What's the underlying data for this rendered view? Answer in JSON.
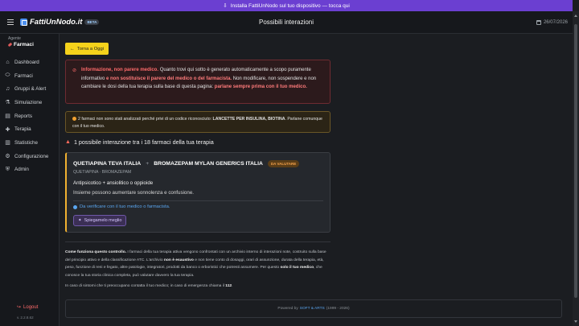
{
  "banner": {
    "icon": "download-icon",
    "text": "Installa FattiUnNodo sul tuo dispositivo — tocca qui"
  },
  "header": {
    "logo_text": "FattiUnNodo.it",
    "logo_badge": "BETA",
    "title": "Possibili interazioni",
    "date": "26/07/2026"
  },
  "sidebar": {
    "agent_label": "Agente",
    "agent_value": "Farmaci",
    "items": [
      {
        "label": "Dashboard",
        "icon": "home-icon"
      },
      {
        "label": "Farmaci",
        "icon": "pill-icon"
      },
      {
        "label": "Gruppi & Alert",
        "icon": "bell-icon"
      },
      {
        "label": "Simulazione",
        "icon": "flask-icon"
      },
      {
        "label": "Reports",
        "icon": "file-icon"
      },
      {
        "label": "Terapia",
        "icon": "medkit-icon"
      },
      {
        "label": "Statistiche",
        "icon": "chart-icon"
      },
      {
        "label": "Configurazione",
        "icon": "gear-icon"
      },
      {
        "label": "Admin",
        "icon": "shield-icon"
      }
    ],
    "logout": "Logout",
    "version": "v. 2.2.8.62"
  },
  "back_button": "Torna a Oggi",
  "warning": {
    "t1": "Informazione, non parere medico.",
    "t2": " Quanto trovi qui sotto è generato automaticamente a scopo puramente informativo ",
    "t3": "e non sostituisce il parere del medico o del farmacista.",
    "t4": " Non modificare, non sospendere e non cambiare le dosi della tua terapia sulla base di questa pagina: ",
    "t5": "parlane sempre prima con il tuo medico."
  },
  "notice": {
    "t1": "2 farmaci non sono stati analizzati perché privi di un codice riconosciuto: ",
    "t2": "LANCETTE PER INSULINA, BIOTINA",
    "t3": ". Parlane comunque con il tuo medico."
  },
  "summary": "1 possibile interazione tra i 18 farmaci della tua terapia",
  "interaction": {
    "drug_a": "QUETIAPINA TEVA ITALIA",
    "drug_b": "BROMAZEPAM MYLAN GENERICS ITALIA",
    "plus": "+",
    "badge": "DA VALUTARE",
    "actives": "QUETIAPINA · BROMAZEPAM",
    "classes": "Antipsicotico + ansiolitico o oppioide",
    "description": "Insieme possono aumentare sonnolenza e confusione.",
    "verify": "Da verificare con il tuo medico o farmacista.",
    "explain_button": "Spiegamelo meglio"
  },
  "info": {
    "h": "Come funziona questo controllo.",
    "p1": " I farmaci della tua terapia attiva vengono confrontati con un archivio interno di interazioni note, costruito sulla base del principio attivo e della classificazione ATC. L'archivio ",
    "b1": "non è esaustivo",
    "p2": " e non tiene conto di dosaggi, orari di assunzione, durata della terapia, età, peso, funzione di reni e fegato, altre patologie, integratori, prodotti da banco o erboristici che potresti assumere. Per questo ",
    "b2": "solo il tuo medico",
    "p3": ", che conosce la tua storia clinica completa, può valutare davvero la tua terapia."
  },
  "emergency": {
    "text": "In caso di sintomi che ti preoccupano contatta il tuo medico; in caso di emergenza chiama il ",
    "number": "112",
    "end": "."
  },
  "footer": {
    "prefix": "Powered by",
    "link": "SOFT & ARTS",
    "years": "(1999 - 2026)"
  },
  "colors": {
    "banner": "#6b3fd1",
    "back_button": "#f5d21b",
    "danger": "#ff6b6b",
    "warning_border": "#f0b030",
    "link": "#5aa6f0"
  }
}
